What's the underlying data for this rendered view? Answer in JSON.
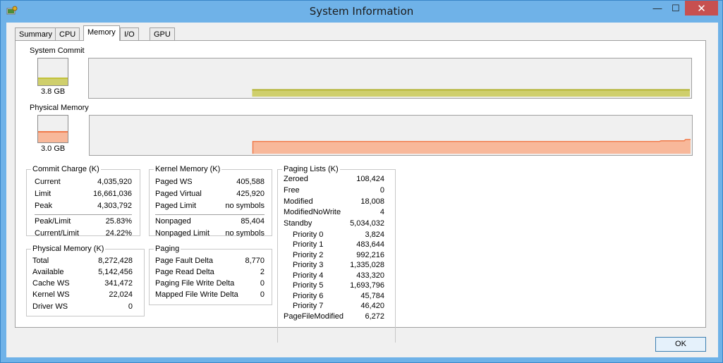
{
  "window": {
    "title": "System Information",
    "minimize": "—",
    "maximize": "☐",
    "close": "✕"
  },
  "tabs": [
    {
      "label": "Summary",
      "active": false
    },
    {
      "label": "CPU",
      "active": false
    },
    {
      "label": "Memory",
      "active": true
    },
    {
      "label": "I/O",
      "active": false
    },
    {
      "label": "GPU",
      "active": false
    }
  ],
  "system_commit": {
    "label": "System Commit",
    "value": "3.8 GB",
    "fill_fraction": 0.228,
    "color": "#c2c23a",
    "fill_color": "#cfcf6c"
  },
  "physical_memory_graph": {
    "label": "Physical Memory",
    "value": "3.0 GB",
    "fill_fraction": 0.37,
    "color": "#f07a4a",
    "fill_color": "#f8b89a"
  },
  "commit_charge": {
    "title": "Commit Charge (K)",
    "rows": [
      {
        "k": "Current",
        "v": "4,035,920"
      },
      {
        "k": "Limit",
        "v": "16,661,036"
      },
      {
        "k": "Peak",
        "v": "4,303,792"
      }
    ],
    "ratios": [
      {
        "k": "Peak/Limit",
        "v": "25.83%"
      },
      {
        "k": "Current/Limit",
        "v": "24.22%"
      }
    ]
  },
  "physical_memory": {
    "title": "Physical Memory (K)",
    "rows": [
      {
        "k": "Total",
        "v": "8,272,428"
      },
      {
        "k": "Available",
        "v": "5,142,456"
      },
      {
        "k": "Cache WS",
        "v": "341,472"
      },
      {
        "k": "Kernel WS",
        "v": "22,024"
      },
      {
        "k": "Driver WS",
        "v": "0"
      }
    ]
  },
  "kernel_memory": {
    "title": "Kernel Memory (K)",
    "rows": [
      {
        "k": "Paged WS",
        "v": "405,588"
      },
      {
        "k": "Paged Virtual",
        "v": "425,920"
      },
      {
        "k": "Paged Limit",
        "v": "no symbols"
      }
    ],
    "rows2": [
      {
        "k": "Nonpaged",
        "v": "85,404"
      },
      {
        "k": "Nonpaged Limit",
        "v": "no symbols"
      }
    ]
  },
  "paging": {
    "title": "Paging",
    "rows": [
      {
        "k": "Page Fault Delta",
        "v": "8,770"
      },
      {
        "k": "Page Read Delta",
        "v": "2"
      },
      {
        "k": "Paging File Write Delta",
        "v": "0"
      },
      {
        "k": "Mapped File Write Delta",
        "v": "0"
      }
    ]
  },
  "paging_lists": {
    "title": "Paging Lists (K)",
    "rows": [
      {
        "k": "Zeroed",
        "v": "108,424"
      },
      {
        "k": "Free",
        "v": "0"
      },
      {
        "k": "Modified",
        "v": "18,008"
      },
      {
        "k": "ModifiedNoWrite",
        "v": "4"
      },
      {
        "k": "Standby",
        "v": "5,034,032"
      }
    ],
    "priorities": [
      {
        "k": "Priority 0",
        "v": "3,824"
      },
      {
        "k": "Priority 1",
        "v": "483,644"
      },
      {
        "k": "Priority 2",
        "v": "992,216"
      },
      {
        "k": "Priority 3",
        "v": "1,335,028"
      },
      {
        "k": "Priority 4",
        "v": "433,320"
      },
      {
        "k": "Priority 5",
        "v": "1,693,796"
      },
      {
        "k": "Priority 6",
        "v": "45,784"
      },
      {
        "k": "Priority 7",
        "v": "46,420"
      }
    ],
    "tail": [
      {
        "k": "PageFileModified",
        "v": "6,272"
      }
    ]
  },
  "ok_button": {
    "label": "OK"
  }
}
